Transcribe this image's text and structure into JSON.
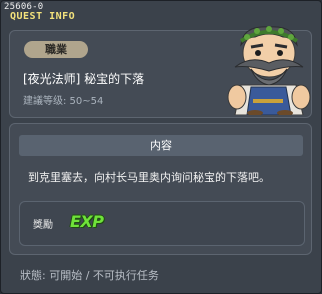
{
  "quest_id": "25606-0",
  "window_title": "QUEST INFO",
  "job_badge": "職業",
  "quest_name": "[夜光法师] 秘宝的下落",
  "level_requirement": "建議等级: 50~54",
  "content_header": "内容",
  "content_text": "到克里塞去，向村长马里奥内询问秘宝的下落吧。",
  "reward_label": "獎勵",
  "reward_exp": "EXP",
  "status": "狀態: 可開始 / 不可执行任务",
  "icons": {
    "npc": "npc-elder-portrait-icon",
    "exp": "exp-reward-icon"
  }
}
